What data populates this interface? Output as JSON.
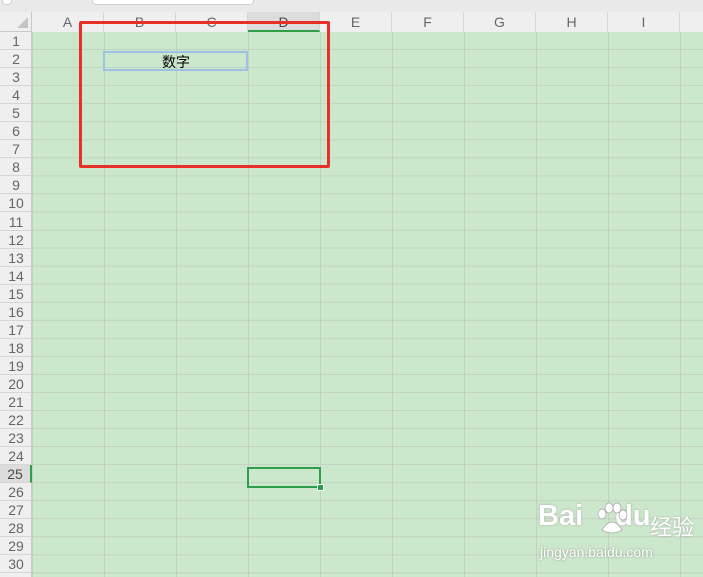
{
  "columns": [
    "A",
    "B",
    "C",
    "D",
    "E",
    "F",
    "G",
    "H",
    "I"
  ],
  "rows": [
    "1",
    "2",
    "3",
    "4",
    "5",
    "6",
    "7",
    "8",
    "9",
    "10",
    "11",
    "12",
    "13",
    "14",
    "15",
    "16",
    "17",
    "18",
    "19",
    "20",
    "21",
    "22",
    "23",
    "24",
    "25",
    "26",
    "27",
    "28",
    "29",
    "30"
  ],
  "active_column": "D",
  "active_row": "25",
  "cells": {
    "B2": "数字"
  },
  "colors": {
    "grid_background": "#cce8cc",
    "selection_green": "#2e9e4a",
    "highlight_red": "#e8302a",
    "b2_border": "#9fc2e4"
  },
  "watermark": {
    "brand": "Bai",
    "brand_suffix": "du",
    "product": "经验",
    "url": "jingyan.baidu.com"
  }
}
